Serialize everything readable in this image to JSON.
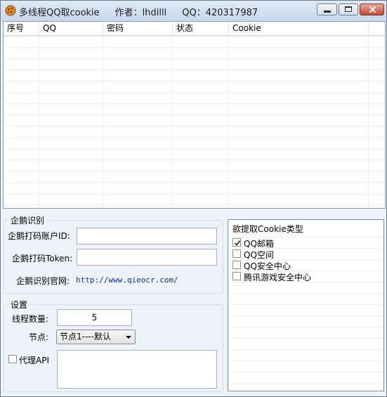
{
  "window": {
    "title_app": "多线程QQ取cookie",
    "title_author": "作者：lhdilll",
    "title_qq": "QQ：420317987"
  },
  "list": {
    "columns": [
      "序号",
      "QQ",
      "密码",
      "状态",
      "Cookie"
    ]
  },
  "ocr_group": {
    "title": "企鹅识别",
    "account_label": "企鹅打码账户ID:",
    "account_value": "",
    "token_label": "企鹅打码Token:",
    "token_value": "",
    "site_label": "企鹅识别官网:",
    "site_link": "http://www.qieocr.com/"
  },
  "settings_group": {
    "title": "设置",
    "threads_label": "线程数量:",
    "threads_value": "5",
    "node_label": "节点:",
    "node_selected": "节点1----默认",
    "proxy_label": "代理API",
    "proxy_checked": false,
    "proxy_value": ""
  },
  "cookie_types": {
    "title": "欲提取Cookie类型",
    "items": [
      {
        "label": "QQ邮箱",
        "checked": true
      },
      {
        "label": "QQ空间",
        "checked": false
      },
      {
        "label": "QQ安全中心",
        "checked": false
      },
      {
        "label": "腾讯游戏安全中心",
        "checked": false
      }
    ]
  },
  "colors": {
    "title_bg": "#c7d8ee",
    "window_bg": "#eef3fa",
    "close_button": "#c44a35",
    "link": "#0b2f9c"
  },
  "icons": {
    "app": "cookie-icon",
    "minimize": "minimize-icon",
    "maximize": "maximize-icon",
    "close": "close-icon",
    "dropdown": "chevron-down-icon",
    "check": "checkmark-icon"
  }
}
